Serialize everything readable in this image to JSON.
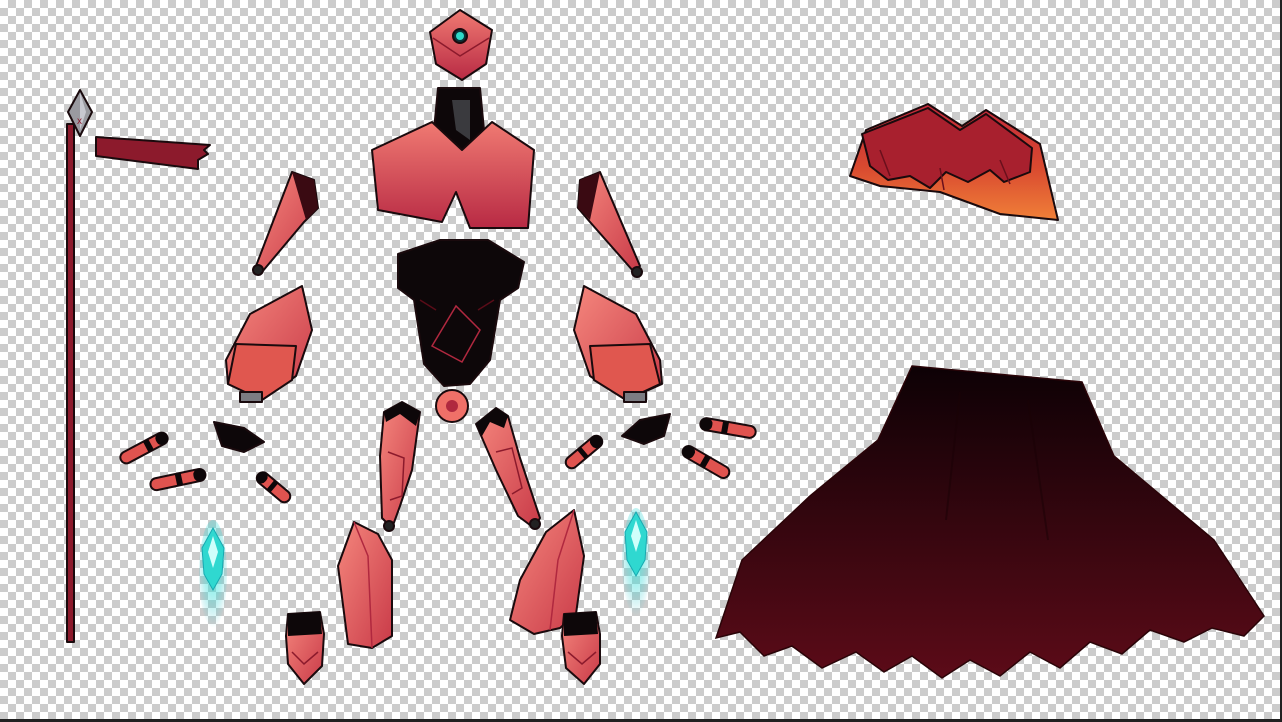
{
  "canvas": {
    "background": "transparency-checkerboard",
    "checker_colors": [
      "#ffffff",
      "#cccccc"
    ]
  },
  "palette": {
    "armor_light": "#f0706a",
    "armor_mid": "#d9454f",
    "armor_dark": "#b0283f",
    "crimson": "#8c1a2c",
    "black": "#0d0709",
    "cape_top": "#120206",
    "cape_bottom": "#5a0c18",
    "cyan_flame": "#2fe0d8",
    "skirt_orange": "#e0552e"
  },
  "sprite_parts": [
    {
      "name": "spear-with-flag",
      "color": "crimson"
    },
    {
      "name": "helmet-head",
      "color": "armor_mid"
    },
    {
      "name": "neck",
      "color": "black"
    },
    {
      "name": "chest-plate",
      "color": "armor_mid"
    },
    {
      "name": "abdomen",
      "color": "black"
    },
    {
      "name": "pelvis-joint",
      "color": "armor_mid"
    },
    {
      "name": "upper-arm-left",
      "color": "armor_mid"
    },
    {
      "name": "upper-arm-right",
      "color": "armor_mid"
    },
    {
      "name": "shoulder-pad-left",
      "color": "armor_mid"
    },
    {
      "name": "shoulder-pad-right",
      "color": "armor_mid"
    },
    {
      "name": "palm-left",
      "color": "black"
    },
    {
      "name": "palm-right",
      "color": "black"
    },
    {
      "name": "fingers-left",
      "color": "armor_mid"
    },
    {
      "name": "fingers-right",
      "color": "armor_mid"
    },
    {
      "name": "thigh-left",
      "color": "armor_mid"
    },
    {
      "name": "thigh-right",
      "color": "armor_mid"
    },
    {
      "name": "shin-left",
      "color": "armor_light"
    },
    {
      "name": "shin-right",
      "color": "armor_light"
    },
    {
      "name": "foot-left",
      "color": "armor_mid"
    },
    {
      "name": "foot-right",
      "color": "armor_mid"
    },
    {
      "name": "thruster-flame-left",
      "color": "cyan_flame"
    },
    {
      "name": "thruster-flame-right",
      "color": "cyan_flame"
    },
    {
      "name": "skirt-piece",
      "color": "skirt_orange"
    },
    {
      "name": "cape",
      "color": "cape_bottom"
    }
  ]
}
